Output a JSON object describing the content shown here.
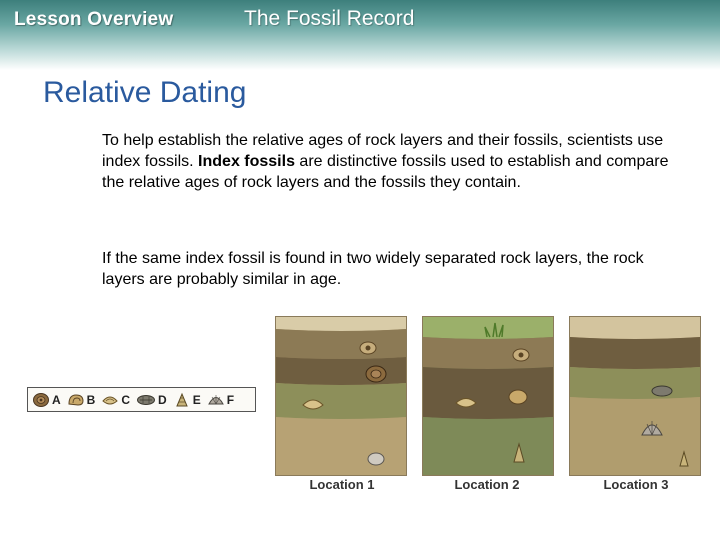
{
  "header": {
    "section": "Lesson Overview",
    "title": "The Fossil Record"
  },
  "slide": {
    "title": "Relative Dating",
    "paragraph1": {
      "before": "To help establish the relative ages of rock layers and their fossils, scientists use index fossils. ",
      "bold": "Index fossils",
      "after": " are distinctive fossils used to establish and compare the relative ages of rock layers and the fossils they contain."
    },
    "paragraph2": "If the same index fossil is found in two widely separated rock layers, the rock layers are probably similar in age."
  },
  "fossil_key": [
    {
      "letter": "A",
      "icon": "ammonite-icon"
    },
    {
      "letter": "B",
      "icon": "snail-icon"
    },
    {
      "letter": "C",
      "icon": "clam-icon"
    },
    {
      "letter": "D",
      "icon": "trilobite-icon"
    },
    {
      "letter": "E",
      "icon": "nautilus-icon"
    },
    {
      "letter": "F",
      "icon": "scallop-icon"
    }
  ],
  "locations": [
    {
      "label": "Location 1"
    },
    {
      "label": "Location 2"
    },
    {
      "label": "Location 3"
    }
  ],
  "colors": {
    "title_blue": "#2a5a9e",
    "header_teal": "#3d7f7c",
    "layer_light": "#c9b68a",
    "layer_brown": "#7a6a4a",
    "layer_olive": "#8d8f5a",
    "layer_tan": "#a9956a",
    "layer_green": "#7e8a58"
  }
}
